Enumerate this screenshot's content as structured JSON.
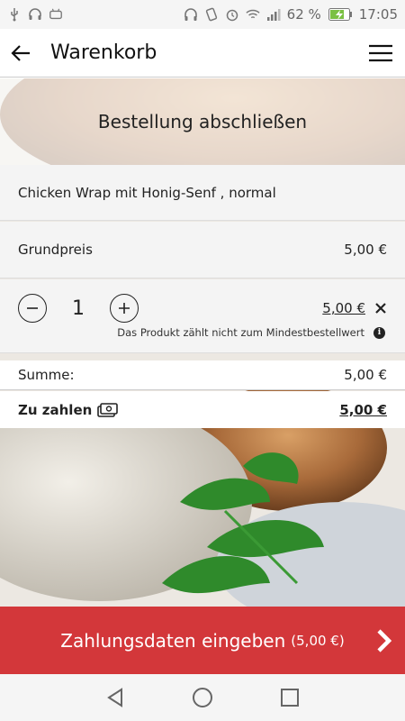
{
  "status_bar": {
    "battery_percent": "62 %",
    "time": "17:05",
    "icons": [
      "usb-icon",
      "headset-icon",
      "android-debug-icon",
      "headphones-icon",
      "vibrate-icon",
      "alarm-icon",
      "wifi-icon",
      "signal-icon",
      "battery-charging-icon"
    ]
  },
  "app_bar": {
    "title": "Warenkorb",
    "back_icon": "arrow-left-icon",
    "menu_icon": "hamburger-menu-icon"
  },
  "heading": "Bestellung abschließen",
  "cart": {
    "product_name": "Chicken Wrap mit Honig-Senf , normal",
    "base_price_label": "Grundpreis",
    "base_price": "5,00 €",
    "quantity": "1",
    "line_total": "5,00 €",
    "min_order_hint": "Das Produkt zählt nicht zum Mindestbestellwert"
  },
  "summary": {
    "sum_label": "Summe:",
    "sum_value": "5,00 €",
    "to_pay_label": "Zu zahlen",
    "to_pay_value": "5,00 €"
  },
  "pay_button": {
    "label": "Zahlungsdaten eingeben",
    "amount": "(5,00 €)"
  },
  "colors": {
    "accent": "#d3373a",
    "panel": "#f4f4f4"
  }
}
